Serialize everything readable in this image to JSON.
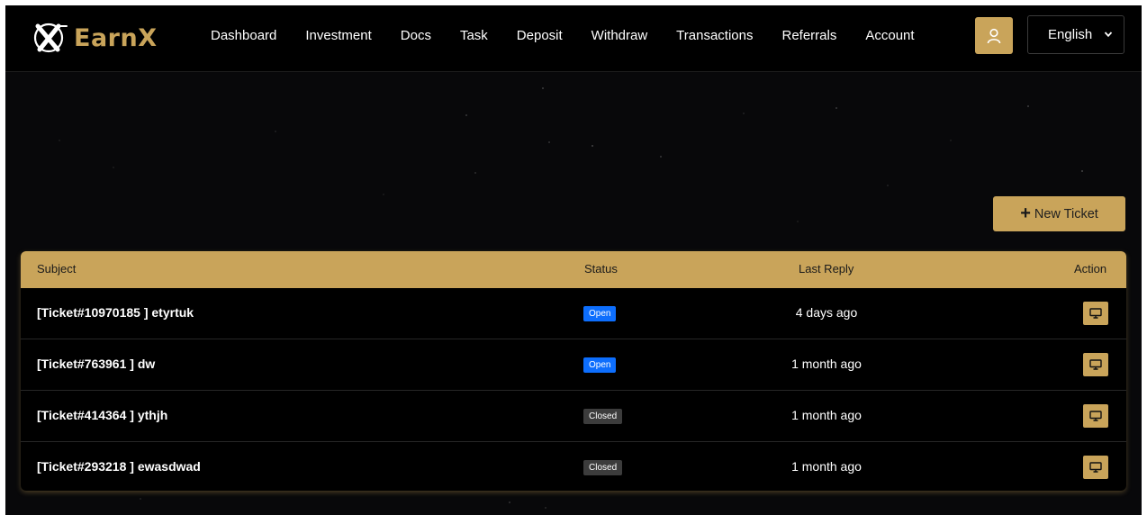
{
  "brand": {
    "name": "EarnX",
    "accent": "#c9a45a"
  },
  "nav": {
    "items": [
      {
        "label": "Dashboard"
      },
      {
        "label": "Investment"
      },
      {
        "label": "Docs"
      },
      {
        "label": "Task"
      },
      {
        "label": "Deposit"
      },
      {
        "label": "Withdraw"
      },
      {
        "label": "Transactions"
      },
      {
        "label": "Referrals"
      },
      {
        "label": "Account"
      }
    ],
    "user_icon": "user-icon",
    "language": "English"
  },
  "toolbar": {
    "new_ticket_label": "New Ticket"
  },
  "table": {
    "headers": {
      "subject": "Subject",
      "status": "Status",
      "last_reply": "Last Reply",
      "action": "Action"
    },
    "rows": [
      {
        "subject": "[Ticket#10970185 ] etyrtuk",
        "status": "Open",
        "last_reply": "4 days ago"
      },
      {
        "subject": "[Ticket#763961 ] dw",
        "status": "Open",
        "last_reply": "1 month ago"
      },
      {
        "subject": "[Ticket#414364 ] ythjh",
        "status": "Closed",
        "last_reply": "1 month ago"
      },
      {
        "subject": "[Ticket#293218 ] ewasdwad",
        "status": "Closed",
        "last_reply": "1 month ago"
      }
    ],
    "action_icon": "monitor-icon",
    "status_colors": {
      "Open": "#0d6efd",
      "Closed": "#3c3c3c"
    }
  }
}
